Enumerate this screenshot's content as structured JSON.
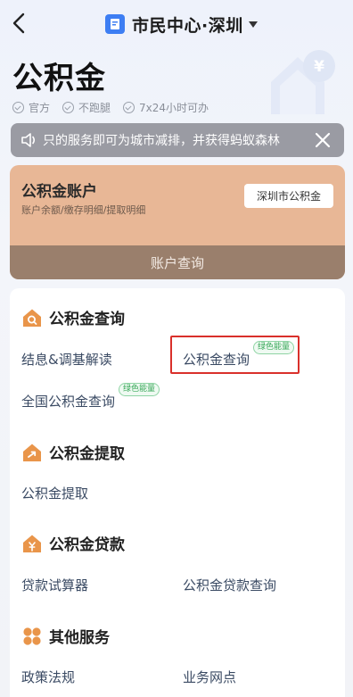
{
  "nav": {
    "title": "市民中心·深圳"
  },
  "hero": {
    "title": "公积金",
    "tags": [
      "官方",
      "不跑腿",
      "7x24小时可办"
    ]
  },
  "notice": {
    "text": "只的服务即可为城市减排，并获得蚂蚁森林"
  },
  "account": {
    "title": "公积金账户",
    "subtitle": "账户余额/缴存明细/提取明细",
    "badge": "深圳市公积金",
    "query_label": "账户查询"
  },
  "sections": {
    "query": {
      "title": "公积金查询",
      "items": [
        "结息&调基解读",
        "公积金查询",
        "全国公积金查询"
      ],
      "badge": "绿色能量"
    },
    "withdraw": {
      "title": "公积金提取",
      "items": [
        "公积金提取"
      ]
    },
    "loan": {
      "title": "公积金贷款",
      "items": [
        "贷款试算器",
        "公积金贷款查询"
      ]
    },
    "other": {
      "title": "其他服务",
      "items": [
        "政策法规",
        "业务网点"
      ]
    }
  },
  "colors": {
    "accent_orange": "#e9954a",
    "account_card": "#e8b796",
    "highlight": "#d9302b",
    "energy_green": "#3aa85a"
  }
}
